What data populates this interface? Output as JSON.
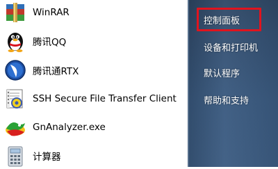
{
  "programs": [
    {
      "label": "WinRAR",
      "icon": "winrar-icon"
    },
    {
      "label": "腾讯QQ",
      "icon": "qq-penguin-icon"
    },
    {
      "label": "腾讯通RTX",
      "icon": "rtx-icon"
    },
    {
      "label": "SSH Secure File Transfer Client",
      "icon": "ssh-file-transfer-icon"
    },
    {
      "label": "GnAnalyzer.exe",
      "icon": "gnanalyzer-icon"
    },
    {
      "label": "计算器",
      "icon": "calculator-icon"
    }
  ],
  "right_menu": [
    {
      "label": "控制面板",
      "highlighted": true
    },
    {
      "label": "设备和打印机"
    },
    {
      "label": "默认程序"
    },
    {
      "label": "帮助和支持"
    }
  ],
  "colors": {
    "highlight_border": "#e0141e",
    "right_pane_bg": "#345072"
  }
}
